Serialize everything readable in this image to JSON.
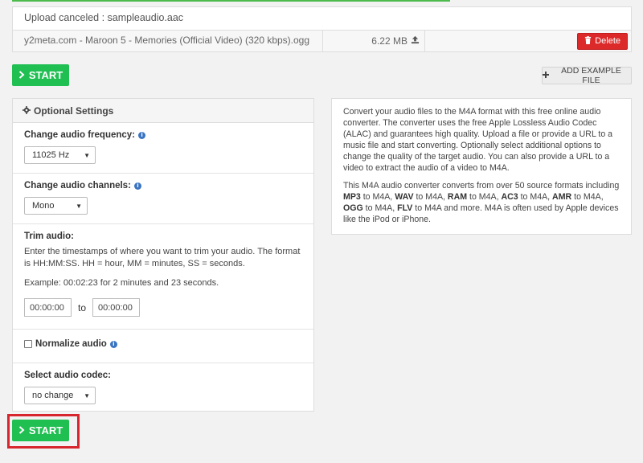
{
  "upload": {
    "status": "Upload canceled : sampleaudio.aac",
    "file_name": "y2meta.com - Maroon 5 - Memories (Official Video) (320 kbps).ogg",
    "file_size": "6.22 MB",
    "delete_label": "Delete"
  },
  "actions": {
    "start_label": "START",
    "add_example_label": "ADD EXAMPLE FILE"
  },
  "settings": {
    "header": "Optional Settings",
    "frequency": {
      "label": "Change audio frequency:",
      "selected": "11025 Hz"
    },
    "channels": {
      "label": "Change audio channels:",
      "selected": "Mono"
    },
    "trim": {
      "label": "Trim audio:",
      "description": "Enter the timestamps of where you want to trim your audio. The format is HH:MM:SS. HH = hour, MM = minutes, SS = seconds.",
      "example": "Example: 00:02:23 for 2 minutes and 23 seconds.",
      "start_placeholder": "00:00:00",
      "end_placeholder": "00:00:00",
      "to_label": "to"
    },
    "normalize": {
      "label": "Normalize audio",
      "checked": false
    },
    "codec": {
      "label": "Select audio codec:",
      "selected": "no change"
    }
  },
  "description": {
    "para1": "Convert your audio files to the M4A format with this free online audio converter. The converter uses the free Apple Lossless Audio Codec (ALAC) and guarantees high quality. Upload a file or provide a URL to a music file and start converting. Optionally select additional options to change the quality of the target audio. You can also provide a URL to a video to extract the audio of a video to M4A.",
    "para2_parts": {
      "intro": "This M4A audio converter converts from over 50 source formats including ",
      "f1": "MP3",
      "t1": " to M4A, ",
      "f2": "WAV",
      "t2": " to M4A, ",
      "f3": "RAM",
      "t3": " to M4A, ",
      "f4": "AC3",
      "t4": " to M4A, ",
      "f5": "AMR",
      "t5": " to M4A, ",
      "f6": "OGG",
      "t6": " to M4A, ",
      "f7": "FLV",
      "t7": " to M4A and more. M4A is often used by Apple devices like the iPod or iPhone."
    }
  },
  "colors": {
    "start_green": "#1fbf52",
    "delete_red": "#dc2a2a",
    "highlight_red": "#d7262d",
    "info_blue": "#3a74c2"
  },
  "icons": {
    "upload": "upload-icon",
    "trash": "trash-icon",
    "chevron": "chevron-right-icon",
    "plus": "plus-icon",
    "gear": "gear-icon",
    "info": "info-icon"
  }
}
